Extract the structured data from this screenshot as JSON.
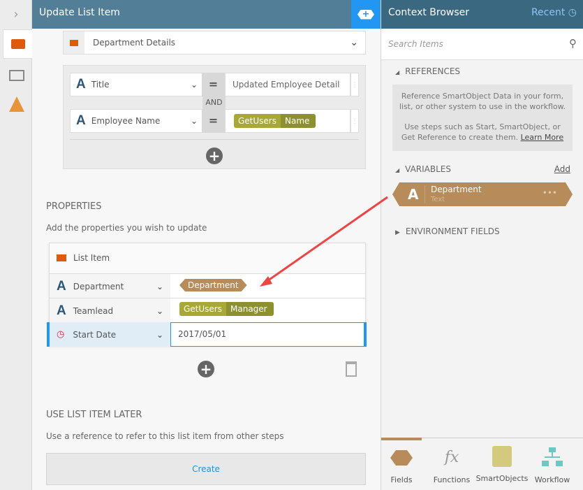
{
  "header": {
    "title": "Update List Item"
  },
  "list_select": {
    "value": "Department Details"
  },
  "filters": [
    {
      "field": "Title",
      "operator": "=",
      "value": "Updated Employee Detail"
    },
    {
      "field": "Employee Name",
      "operator": "=",
      "value_ref": {
        "source": "GetUsers",
        "field": "Name"
      }
    }
  ],
  "filter_join": "AND",
  "properties": {
    "heading": "PROPERTIES",
    "subtitle": "Add the properties you wish to update",
    "box_title": "List Item",
    "rows": [
      {
        "field": "Department",
        "variable": "Department"
      },
      {
        "field": "Teamlead",
        "ref": {
          "source": "GetUsers",
          "field": "Manager"
        }
      },
      {
        "field": "Start Date",
        "value": "2017/05/01"
      }
    ]
  },
  "later": {
    "heading": "USE LIST ITEM LATER",
    "subtitle": "Use a reference to refer to this list item from other steps",
    "create_label": "Create"
  },
  "context": {
    "title": "Context Browser",
    "recent": "Recent",
    "search_placeholder": "Search Items",
    "references": {
      "label": "REFERENCES",
      "text1": "Reference SmartObject Data in your form, list, or other system to use in the workflow.",
      "text2": "Use steps such as Start, SmartObject, or Get Reference to create them.",
      "link": "Learn More"
    },
    "variables": {
      "label": "VARIABLES",
      "add": "Add",
      "items": [
        {
          "name": "Department",
          "type": "Text"
        }
      ]
    },
    "env": {
      "label": "ENVIRONMENT FIELDS"
    },
    "tabs": [
      "Fields",
      "Functions",
      "SmartObjects",
      "Workflow"
    ]
  },
  "colors": {
    "header": "#527e98",
    "accent": "#2196f3",
    "variable": "#b78b5a",
    "ref": "#a8a836"
  }
}
